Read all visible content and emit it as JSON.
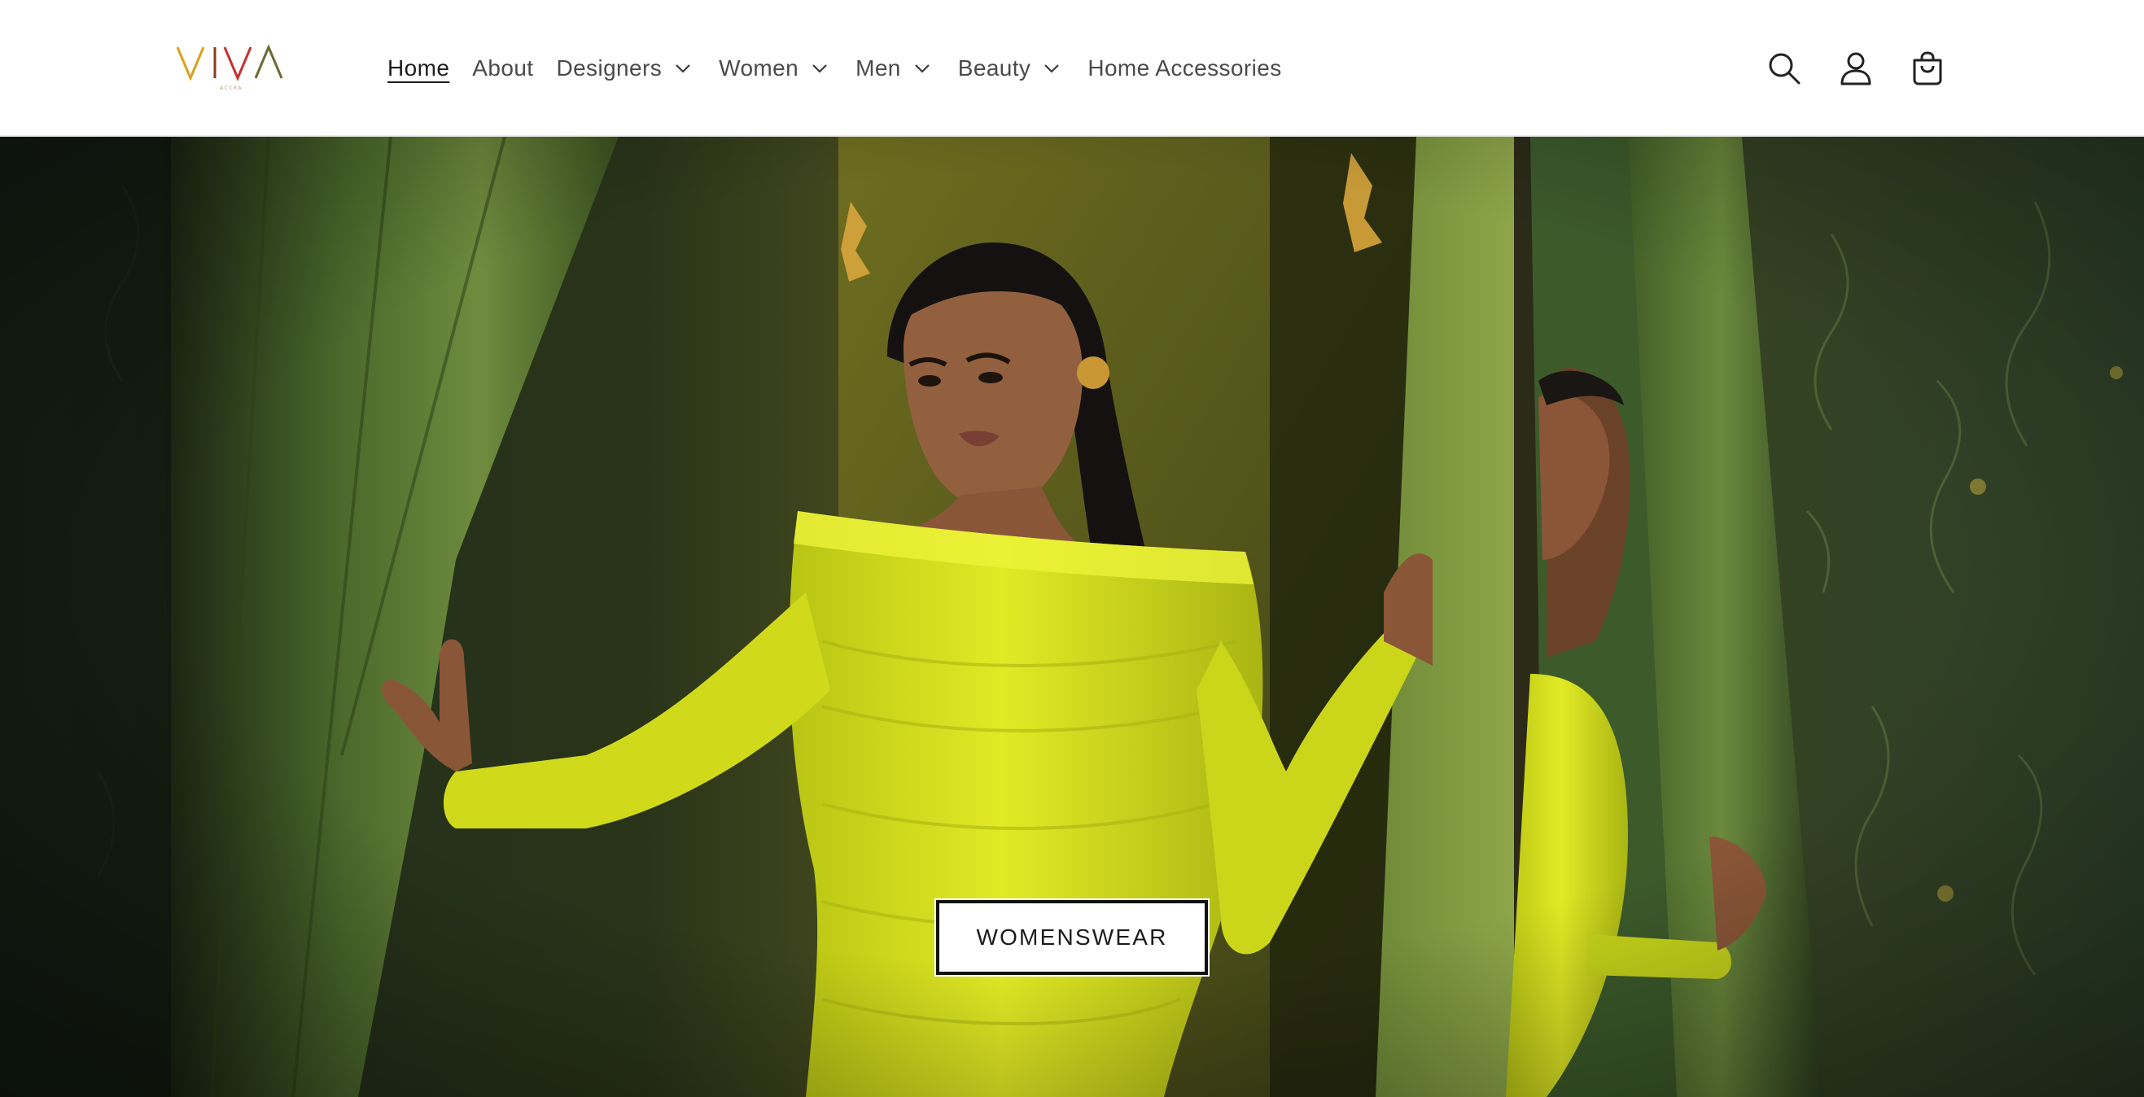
{
  "brand": {
    "logo_text": "VIVA",
    "logo_subtext": "ACCRA",
    "colors": {
      "v_left": "#d9a21c",
      "i": "#8a3b1d",
      "v_right": "#c7302c",
      "a": "#6b6a34"
    }
  },
  "nav": {
    "items": [
      {
        "label": "Home",
        "active": true,
        "has_dropdown": false
      },
      {
        "label": "About",
        "active": false,
        "has_dropdown": false
      },
      {
        "label": "Designers",
        "active": false,
        "has_dropdown": true
      },
      {
        "label": "Women",
        "active": false,
        "has_dropdown": true
      },
      {
        "label": "Men",
        "active": false,
        "has_dropdown": true
      },
      {
        "label": "Beauty",
        "active": false,
        "has_dropdown": true
      },
      {
        "label": "Home Accessories",
        "active": false,
        "has_dropdown": false
      }
    ]
  },
  "header_icons": [
    {
      "name": "search-icon"
    },
    {
      "name": "account-icon"
    },
    {
      "name": "cart-icon"
    }
  ],
  "hero": {
    "cta_label": "WOMENSWEAR",
    "palette": {
      "dress": "#d8e21a",
      "curtain": "#5f7a35",
      "wall": "#3f4a1e",
      "skin": "#8a5638"
    }
  }
}
